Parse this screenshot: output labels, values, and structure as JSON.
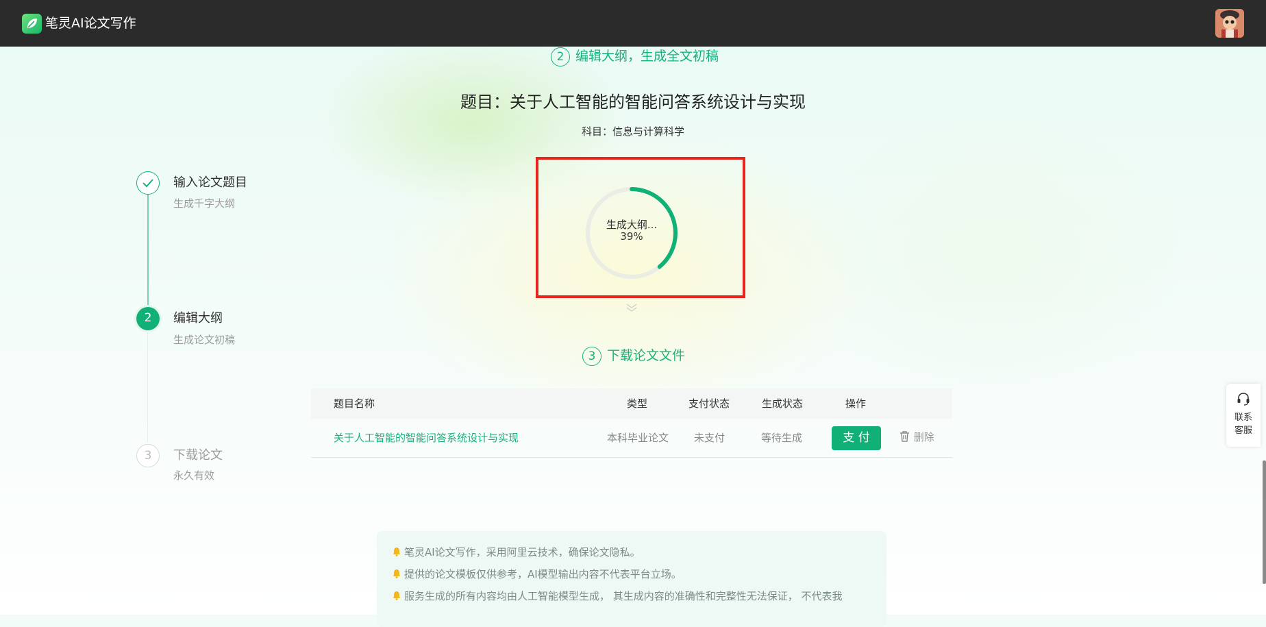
{
  "header": {
    "app_title": "笔灵AI论文写作",
    "logo_icon": "leaf-logo-icon",
    "avatar_icon": "user-avatar"
  },
  "steps": [
    {
      "title": "输入论文题目",
      "subtitle": "生成千字大纲",
      "state": "done",
      "marker": "✓"
    },
    {
      "title": "编辑大纲",
      "subtitle": "生成论文初稿",
      "state": "active",
      "marker": "2"
    },
    {
      "title": "下载论文",
      "subtitle": "永久有效",
      "state": "pending",
      "marker": "3"
    }
  ],
  "section2": {
    "num": "2",
    "label": "编辑大纲，生成全文初稿"
  },
  "topic": {
    "title": "题目：关于人工智能的智能问答系统设计与实现",
    "subject": "科目：信息与计算科学"
  },
  "progress": {
    "label": "生成大纲...",
    "percent_text": "39%",
    "percent": 39
  },
  "section3": {
    "num": "3",
    "label": "下载论文文件"
  },
  "table": {
    "headers": [
      "题目名称",
      "类型",
      "支付状态",
      "生成状态",
      "操作"
    ],
    "rows": [
      {
        "name": "关于人工智能的智能问答系统设计与实现",
        "type": "本科毕业论文",
        "pay_status": "未支付",
        "gen_status": "等待生成",
        "pay_button": "支 付",
        "delete_label": "删除"
      }
    ]
  },
  "notices": [
    "笔灵AI论文写作，采用阿里云技术，确保论文隐私。",
    "提供的论文模板仅供参考，AI模型输出内容不代表平台立场。",
    "服务生成的所有内容均由人工智能模型生成， 其生成内容的准确性和完整性无法保证， 不代表我"
  ],
  "service": {
    "label_line1": "联系",
    "label_line2": "客服",
    "icon": "headset-icon"
  },
  "colors": {
    "accent": "#11b076",
    "highlight": "#e8251c",
    "topbar": "#2b2b2b"
  }
}
